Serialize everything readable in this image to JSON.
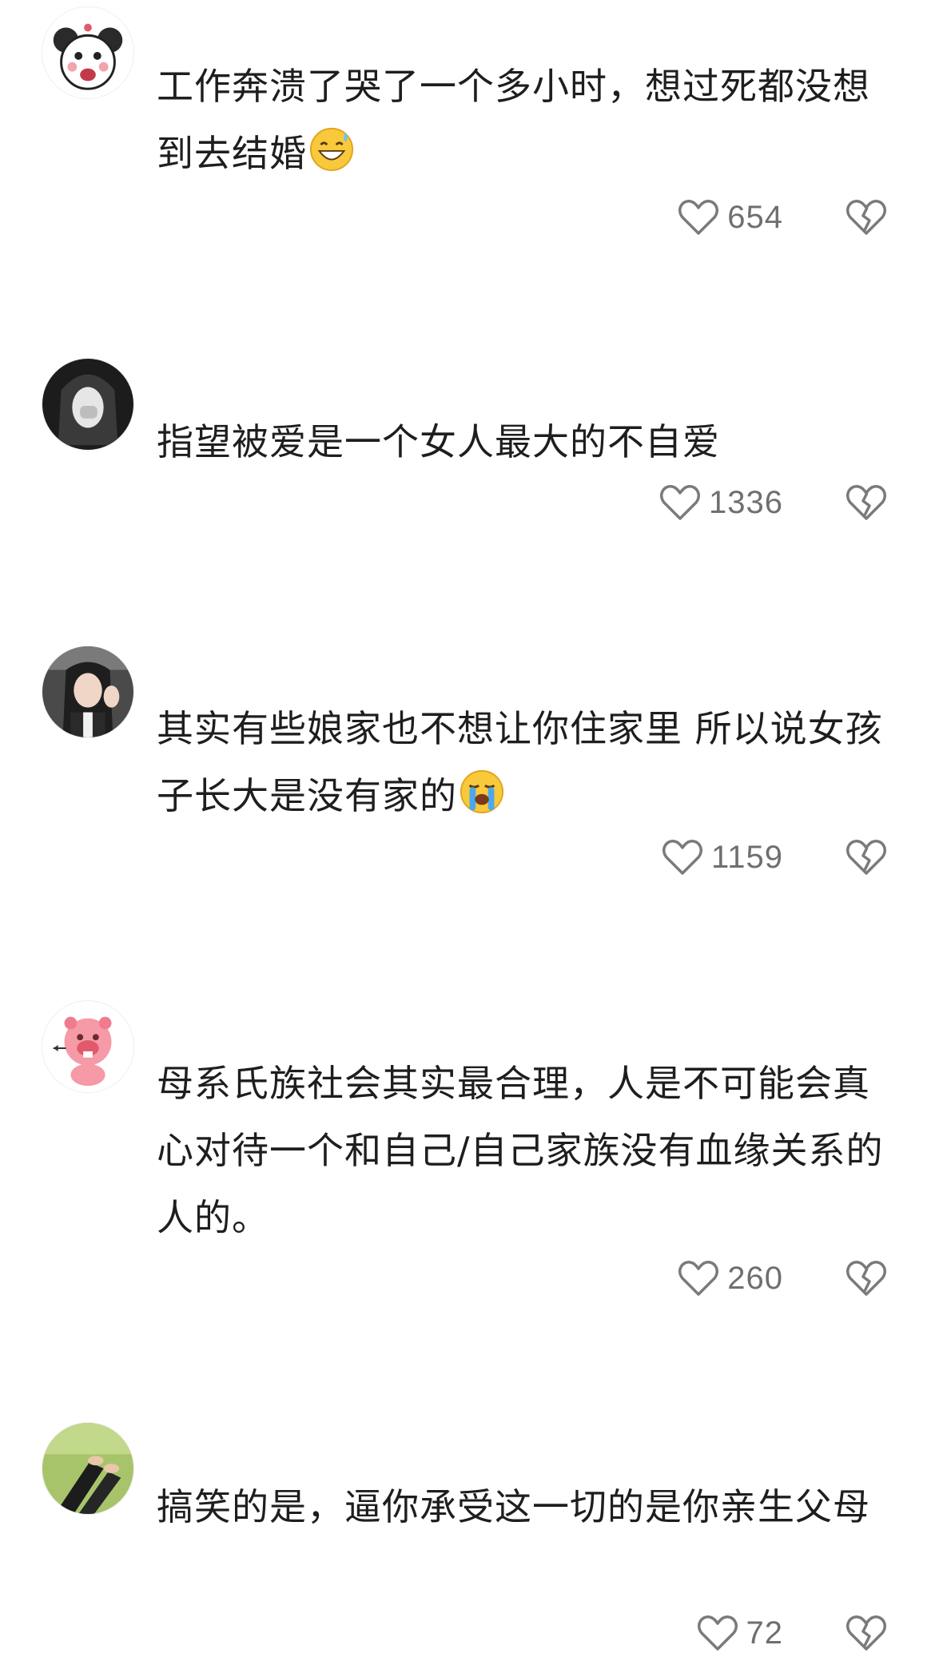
{
  "comments": [
    {
      "avatar": "cartoon-girl-avatar",
      "text": "工作奔溃了哭了一个多小时，想过死都没想到去结婚",
      "emoji": "grinning-sweat-emoji",
      "likes": "654"
    },
    {
      "avatar": "grayscale-girl-photo-avatar",
      "text": "指望被爱是一个女人最大的不自爱",
      "emoji": "",
      "likes": "1336"
    },
    {
      "avatar": "waving-girl-photo-avatar",
      "text": "其实有些娘家也不想让你住家里 所以说女孩子长大是没有家的",
      "emoji": "loudly-crying-emoji",
      "likes": "1159"
    },
    {
      "avatar": "pink-beaver-avatar",
      "text": "母系氏族社会其实最合理，人是不可能会真心对待一个和自己/自己家族没有血缘关系的人的。",
      "emoji": "",
      "likes": "260"
    },
    {
      "avatar": "feet-on-grass-photo-avatar",
      "text": "搞笑的是，逼你承受这一切的是你亲生父母",
      "emoji": "",
      "likes": "72"
    }
  ],
  "icons": {
    "like": "heart-outline-icon",
    "dislike": "broken-heart-icon"
  },
  "colors": {
    "text": "#1e1e1e",
    "count": "#6f6f6f",
    "icon": "#7a7a7a"
  }
}
